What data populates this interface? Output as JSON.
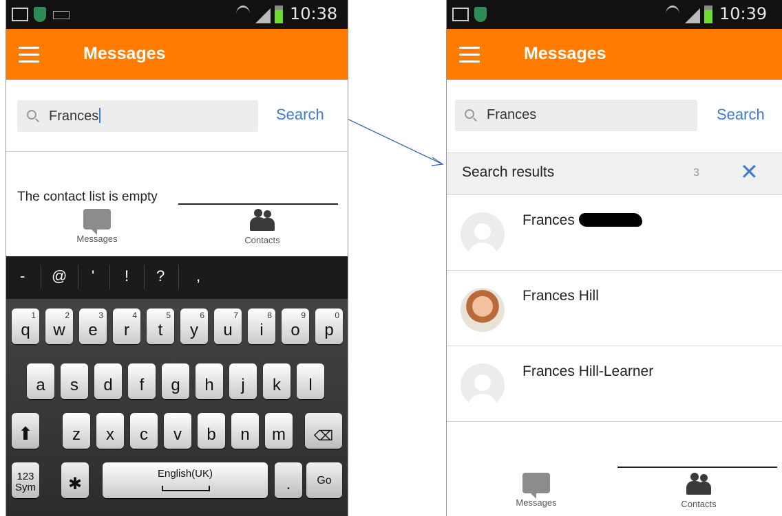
{
  "left_screen": {
    "status_bar": {
      "time": "10:38"
    },
    "app_bar": {
      "title": "Messages"
    },
    "search": {
      "value": "Frances",
      "button_label": "Search"
    },
    "empty_state": "The contact list is empty",
    "bottom_nav": [
      {
        "label": "Messages",
        "icon": "chat-bubble-icon"
      },
      {
        "label": "Contacts",
        "icon": "contacts-icon",
        "active": true
      }
    ],
    "keyboard": {
      "symbol_bar": [
        "-",
        "@",
        "'",
        "!",
        "?",
        ","
      ],
      "row1": [
        {
          "key": "q",
          "sup": "1"
        },
        {
          "key": "w",
          "sup": "2"
        },
        {
          "key": "e",
          "sup": "3"
        },
        {
          "key": "r",
          "sup": "4"
        },
        {
          "key": "t",
          "sup": "5"
        },
        {
          "key": "y",
          "sup": "6"
        },
        {
          "key": "u",
          "sup": "7"
        },
        {
          "key": "i",
          "sup": "8"
        },
        {
          "key": "o",
          "sup": "9"
        },
        {
          "key": "p",
          "sup": "0"
        }
      ],
      "row2": [
        "a",
        "s",
        "d",
        "f",
        "g",
        "h",
        "j",
        "k",
        "l"
      ],
      "row3": [
        "z",
        "x",
        "c",
        "v",
        "b",
        "n",
        "m"
      ],
      "sym_key_line1": "123",
      "sym_key_line2": "Sym",
      "space_label": "English(UK)",
      "period_key": ".",
      "go_key": "Go"
    }
  },
  "right_screen": {
    "status_bar": {
      "time": "10:39"
    },
    "app_bar": {
      "title": "Messages"
    },
    "search": {
      "value": "Frances",
      "button_label": "Search"
    },
    "results_header": {
      "title": "Search results",
      "count": "3"
    },
    "results": [
      {
        "name": "Frances",
        "redacted_surname": true,
        "avatar": "placeholder"
      },
      {
        "name": "Frances Hill",
        "avatar": "photo"
      },
      {
        "name": "Frances Hill-Learner",
        "avatar": "placeholder"
      }
    ],
    "bottom_nav": [
      {
        "label": "Messages",
        "icon": "chat-bubble-icon"
      },
      {
        "label": "Contacts",
        "icon": "contacts-icon",
        "active": true
      }
    ]
  },
  "colors": {
    "app_bar": "#ff7c00",
    "link_blue": "#3b7bd8",
    "status_bar": "#111111"
  }
}
